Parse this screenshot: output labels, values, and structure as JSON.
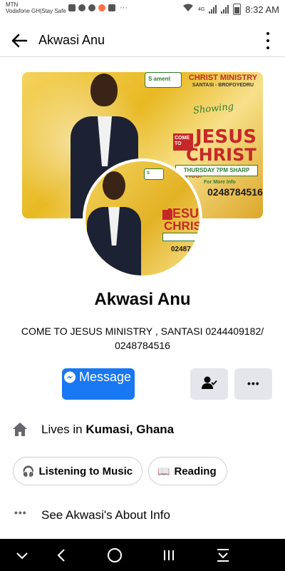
{
  "status_bar": {
    "carrier_line1": "MTN",
    "carrier_line2": "Vodafone GH|Stay Safe",
    "time": "8:32 AM",
    "network_label": "4G",
    "icons": [
      "n-icon",
      "wifi-icon",
      "whatsapp-icon",
      "camera-icon",
      "notification-icon",
      "more-dots-icon"
    ]
  },
  "header": {
    "title": "Akwasi Anu",
    "back_icon": "back-arrow-icon",
    "menu_icon": "kebab-menu-icon"
  },
  "cover": {
    "ministry_title": "CHRIST MINISTRY",
    "ministry_location": "SANTASI - BROFOYEDRU",
    "showing_text": "Showing",
    "come_to": "COME TO",
    "jesus": "JESUS",
    "christ": "CHRIST",
    "hour": "Hour",
    "schedule": "THURSDAY 7PM SHARP",
    "more_info": "For More Info",
    "phone": "0248784516",
    "logo_text": "S ament"
  },
  "avatar": {
    "come_to": "COME TO",
    "jesus": "JESU",
    "christ": "CHRIS",
    "phone": "02487"
  },
  "profile": {
    "name": "Akwasi Anu",
    "bio": "COME TO JESUS MINISTRY , SANTASI 0244409182/ 0248784516"
  },
  "actions": {
    "message_label": "Message",
    "more_label": "•••"
  },
  "details": {
    "lives_prefix": "Lives in ",
    "lives_place": "Kumasi, Ghana",
    "interests": [
      {
        "icon": "🎧",
        "label": "Listening to Music"
      },
      {
        "icon": "📖",
        "label": "Reading"
      }
    ],
    "about_dots": "•••",
    "about_text": "See Akwasi's About Info"
  },
  "colors": {
    "accent": "#1877f2",
    "button_grey": "#e4e6eb",
    "text": "#050505",
    "nav_bar": "#000000"
  }
}
